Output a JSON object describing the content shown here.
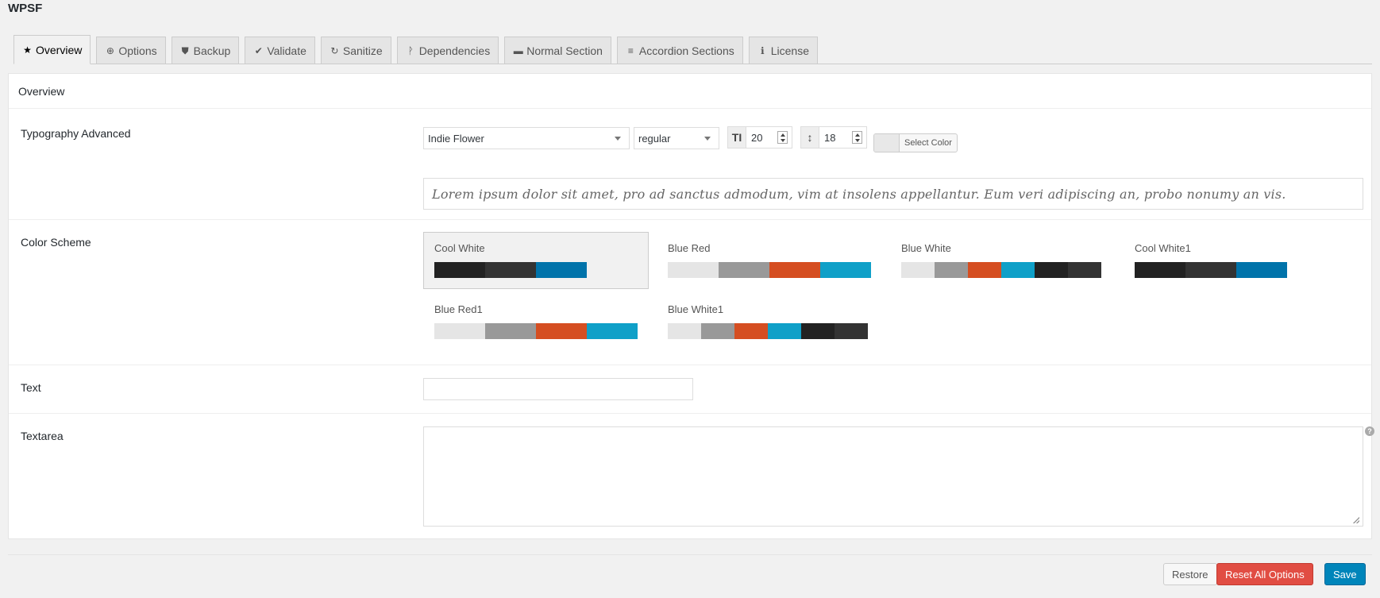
{
  "app": {
    "title": "WPSF"
  },
  "tabs": [
    {
      "label": "Overview",
      "icon": "star-icon",
      "glyph": "★"
    },
    {
      "label": "Options",
      "icon": "plus-circle-icon",
      "glyph": "⊕"
    },
    {
      "label": "Backup",
      "icon": "shield-icon",
      "glyph": "⛊"
    },
    {
      "label": "Validate",
      "icon": "check-circle-icon",
      "glyph": "✔"
    },
    {
      "label": "Sanitize",
      "icon": "refresh-icon",
      "glyph": "↻"
    },
    {
      "label": "Dependencies",
      "icon": "code-fork-icon",
      "glyph": "ᚹ"
    },
    {
      "label": "Normal Section",
      "icon": "minus-icon",
      "glyph": "▬"
    },
    {
      "label": "Accordion Sections",
      "icon": "bars-icon",
      "glyph": "≡"
    },
    {
      "label": "License",
      "icon": "info-circle-icon",
      "glyph": "ℹ"
    }
  ],
  "panel": {
    "title": "Overview"
  },
  "typography": {
    "label": "Typography Advanced",
    "font_family": "Indie Flower",
    "font_variant": "regular",
    "font_size": "20",
    "font_size_icon": "text-height-icon",
    "font_size_glyph": "TI",
    "line_height": "18",
    "line_height_icon": "arrows-v-icon",
    "line_height_glyph": "↕",
    "color_button": "Select Color",
    "preview_text": "Lorem ipsum dolor sit amet, pro ad sanctus admodum, vim at insolens appellantur. Eum veri adipiscing an, probo nonumy an vis."
  },
  "color_scheme": {
    "label": "Color Scheme",
    "schemes": [
      {
        "name": "Cool White",
        "selected": true,
        "colors": [
          "#222222",
          "#333333",
          "#0073aa"
        ]
      },
      {
        "name": "Blue Red",
        "selected": false,
        "colors": [
          "#e5e5e5",
          "#999999",
          "#d54e21",
          "#0fa0c8"
        ]
      },
      {
        "name": "Blue White",
        "selected": false,
        "colors": [
          "#e5e5e5",
          "#999999",
          "#d54e21",
          "#0fa0c8",
          "#222222",
          "#333333"
        ]
      },
      {
        "name": "Cool White1",
        "selected": false,
        "colors": [
          "#222222",
          "#333333",
          "#0073aa"
        ]
      },
      {
        "name": "Blue Red1",
        "selected": false,
        "colors": [
          "#e5e5e5",
          "#999999",
          "#d54e21",
          "#0fa0c8"
        ]
      },
      {
        "name": "Blue White1",
        "selected": false,
        "colors": [
          "#e5e5e5",
          "#999999",
          "#d54e21",
          "#0fa0c8",
          "#222222",
          "#333333"
        ]
      }
    ]
  },
  "text_field": {
    "label": "Text",
    "value": ""
  },
  "textarea_field": {
    "label": "Textarea",
    "value": "",
    "help_icon": "question-circle-icon",
    "help_glyph": "?"
  },
  "footer": {
    "restore": "Restore",
    "reset": "Reset All Options",
    "save": "Save"
  },
  "colors": {
    "accent": "#0085ba",
    "danger": "#e14d43",
    "background": "#f1f1f1"
  }
}
